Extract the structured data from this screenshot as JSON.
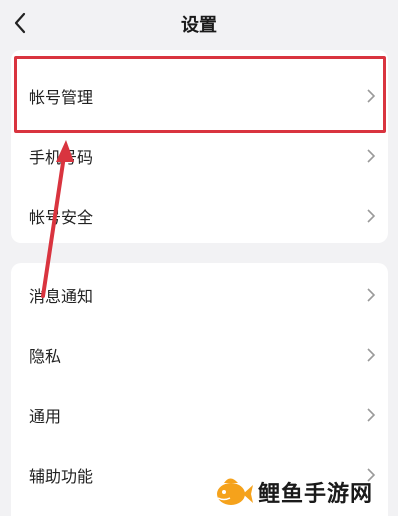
{
  "header": {
    "title": "设置"
  },
  "group1": [
    {
      "label": "帐号管理"
    },
    {
      "label": "手机号码"
    },
    {
      "label": "帐号安全"
    }
  ],
  "group2": [
    {
      "label": "消息通知"
    },
    {
      "label": "隐私"
    },
    {
      "label": "通用"
    },
    {
      "label": "辅助功能"
    }
  ],
  "watermark": {
    "text": "鲤鱼手游网"
  },
  "colors": {
    "highlight": "#d9343f",
    "background": "#f2f2f4",
    "chevron": "#9a9a9a",
    "fish": "#f5a21b"
  }
}
